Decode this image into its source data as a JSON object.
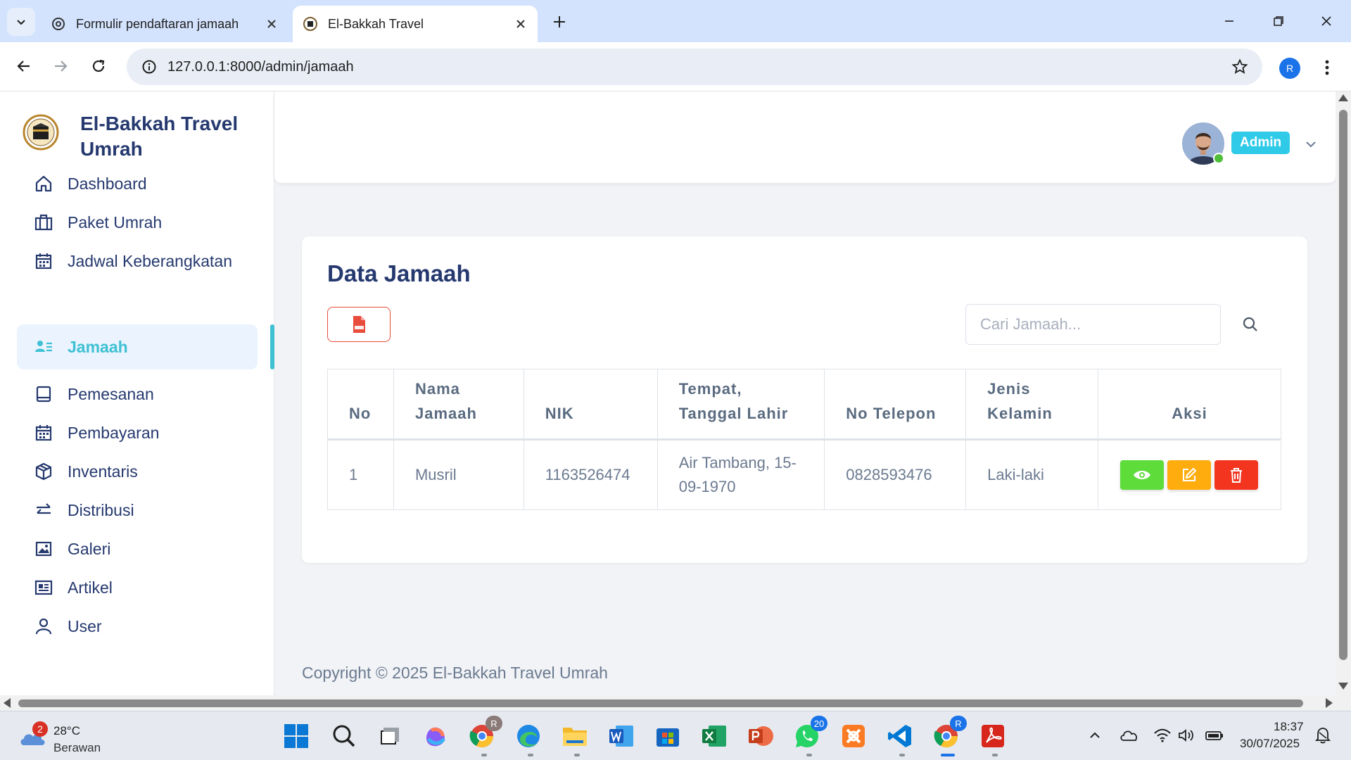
{
  "browser": {
    "tabs": [
      {
        "title": "Formulir pendaftaran jamaah",
        "active": false
      },
      {
        "title": "El-Bakkah Travel",
        "active": true
      }
    ],
    "url": "127.0.0.1:8000/admin/jamaah",
    "profile_initial": "R"
  },
  "app": {
    "brand_name": "El-Bakkah Travel Umrah",
    "nav": [
      {
        "label": "Dashboard",
        "icon": "home-icon",
        "active": false
      },
      {
        "label": "Paket Umrah",
        "icon": "briefcase-icon",
        "active": false
      },
      {
        "label": "Jadwal Keberangkatan",
        "icon": "calendar-icon",
        "active": false
      },
      {
        "label": "Jamaah",
        "icon": "users-list-icon",
        "active": true
      },
      {
        "label": "Pemesanan",
        "icon": "book-icon",
        "active": false
      },
      {
        "label": "Pembayaran",
        "icon": "calendar-icon",
        "active": false
      },
      {
        "label": "Inventaris",
        "icon": "box-icon",
        "active": false
      },
      {
        "label": "Distribusi",
        "icon": "arrows-swap-icon",
        "active": false
      },
      {
        "label": "Galeri",
        "icon": "image-icon",
        "active": false
      },
      {
        "label": "Artikel",
        "icon": "newspaper-icon",
        "active": false
      },
      {
        "label": "User",
        "icon": "user-icon",
        "active": false
      }
    ],
    "user": {
      "role": "Admin",
      "status": "online"
    }
  },
  "page": {
    "title": "Data Jamaah",
    "search_placeholder": "Cari Jamaah...",
    "table": {
      "headers": [
        "No",
        "Nama Jamaah",
        "NIK",
        "Tempat, Tanggal Lahir",
        "No Telepon",
        "Jenis Kelamin",
        "Aksi"
      ],
      "rows": [
        {
          "no": "1",
          "nama": "Musril",
          "nik": "1163526474",
          "ttl": "Air Tambang, 15-09-1970",
          "telepon": "0828593476",
          "jenis_kelamin": "Laki-laki"
        }
      ]
    },
    "copyright": "Copyright © 2025 El-Bakkah Travel Umrah"
  },
  "colors": {
    "accent": "#3ec1d3",
    "brand_text": "#25396f",
    "view_button": "#5ddc3a",
    "edit_button": "#ffad0e",
    "delete_button": "#f3341f",
    "role_badge": "#2ecae8"
  },
  "taskbar": {
    "weather": {
      "temp": "28°C",
      "desc": "Berawan",
      "badge": "2"
    },
    "apps": [
      {
        "name": "windows-start-icon",
        "badge": ""
      },
      {
        "name": "search-icon",
        "badge": ""
      },
      {
        "name": "task-view-icon",
        "badge": ""
      },
      {
        "name": "copilot-icon",
        "badge": ""
      },
      {
        "name": "chrome-icon",
        "badge": "R"
      },
      {
        "name": "edge-icon",
        "badge": ""
      },
      {
        "name": "file-explorer-icon",
        "badge": ""
      },
      {
        "name": "word-icon",
        "badge": ""
      },
      {
        "name": "microsoft-store-icon",
        "badge": ""
      },
      {
        "name": "excel-icon",
        "badge": ""
      },
      {
        "name": "powerpoint-icon",
        "badge": ""
      },
      {
        "name": "whatsapp-icon",
        "badge": "20"
      },
      {
        "name": "xampp-icon",
        "badge": ""
      },
      {
        "name": "vscode-icon",
        "badge": ""
      },
      {
        "name": "chrome-icon",
        "badge": "R"
      },
      {
        "name": "acrobat-icon",
        "badge": ""
      }
    ],
    "time": "18:37",
    "date": "30/07/2025"
  }
}
